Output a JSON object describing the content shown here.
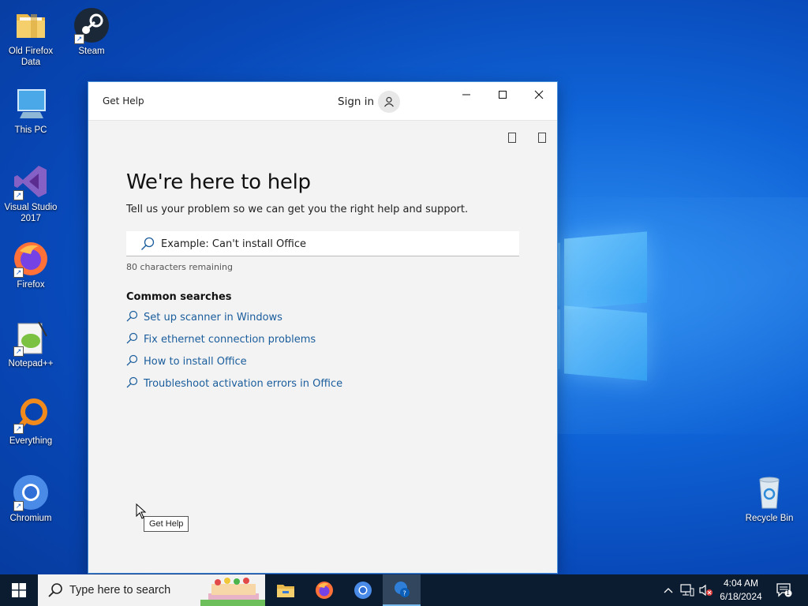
{
  "desktop": {
    "icons": [
      {
        "label": "Old Firefox Data"
      },
      {
        "label": "Steam"
      },
      {
        "label": "This PC"
      },
      {
        "label": "Visual Studio 2017"
      },
      {
        "label": "Firefox"
      },
      {
        "label": "Notepad++"
      },
      {
        "label": "Everything"
      },
      {
        "label": "Chromium"
      },
      {
        "label": "Recycle Bin"
      }
    ]
  },
  "window": {
    "title": "Get Help",
    "sign_in": "Sign in",
    "heading": "We're here to help",
    "subtext": "Tell us your problem so we can get you the right help and support.",
    "search_placeholder": "Example: Can't install Office",
    "remaining": "80 characters remaining",
    "common_title": "Common searches",
    "common_searches": [
      "Set up scanner in Windows",
      "Fix ethernet connection problems",
      "How to install Office",
      "Troubleshoot activation errors in Office"
    ]
  },
  "tooltip": "Get Help",
  "taskbar": {
    "search_placeholder": "Type here to search",
    "time": "4:04 AM",
    "date": "6/18/2024",
    "notification_count": "1"
  },
  "colors": {
    "link": "#1a5d9c",
    "taskbar": "#0c1c30",
    "desktop_bg": "#0f63d6"
  }
}
